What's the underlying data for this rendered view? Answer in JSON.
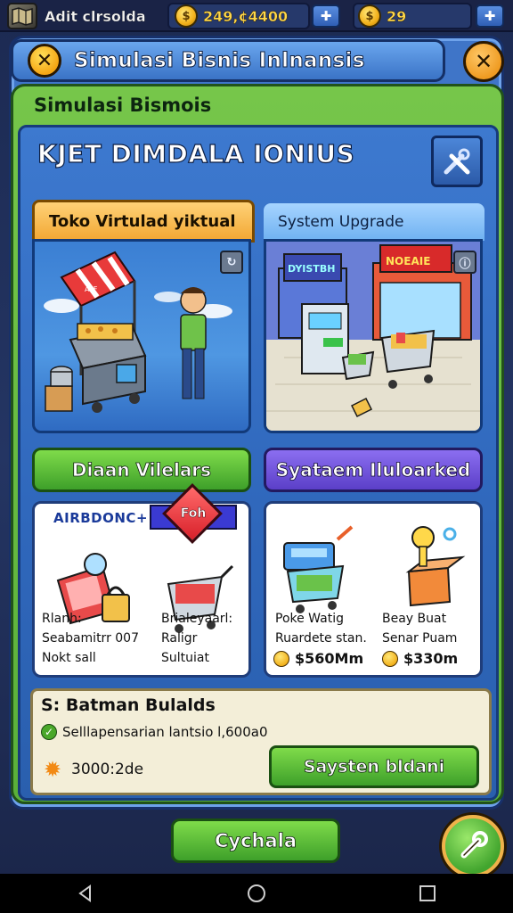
{
  "topbar": {
    "app_title": "Adit clrsolda",
    "currency_value": "249,¢4400",
    "gems_value": "29",
    "plus_icon": "plus-arrow-icon"
  },
  "window": {
    "title": "Simulasi Bisnis Inlnansis",
    "close_icon": "close-icon"
  },
  "panel": {
    "title": "Simulasi Bismois",
    "banner": "KJET DIMDALA IONIUS",
    "banner_button_icon": "tools-icon"
  },
  "tabs": {
    "left_label": "Toko Virtulad yiktual",
    "right_label": "System Upgrade"
  },
  "scenes": {
    "left_stall_label": "AllF",
    "right_store_sign_left": "DYISTBH",
    "right_store_sign_right": "NOEAIE"
  },
  "buttons": {
    "green": "Diaan Vilelars",
    "purple": "Syataem Iluloarked"
  },
  "cards": {
    "left": {
      "tag": "AIRBDONC+",
      "badge": "Foh",
      "col1": [
        "Rlanh:",
        "Seabamitrr 007",
        "Nokt sall"
      ],
      "col2": [
        "Brialeyaarl:",
        "Raligr Sultuiat"
      ]
    },
    "right": {
      "col1": [
        "Poke Watig",
        "Ruardete stan."
      ],
      "col2": [
        "Beay Buat",
        "Senar Puam"
      ],
      "price1": "$560Mm",
      "price2": "$330m"
    }
  },
  "bottom": {
    "title": "S: Batman Bulalds",
    "check_text": "Selllapensarian lantsio l,600a0",
    "cost": "3000:2de",
    "button": "Saysten bldani"
  },
  "footer": {
    "button": "Cychala"
  },
  "colors": {
    "frame_blue": "#3f75c8",
    "panel_green": "#5ab03a",
    "accent_orange": "#f2a734",
    "button_green": "#3ea02a",
    "button_purple": "#5b3fc8"
  }
}
